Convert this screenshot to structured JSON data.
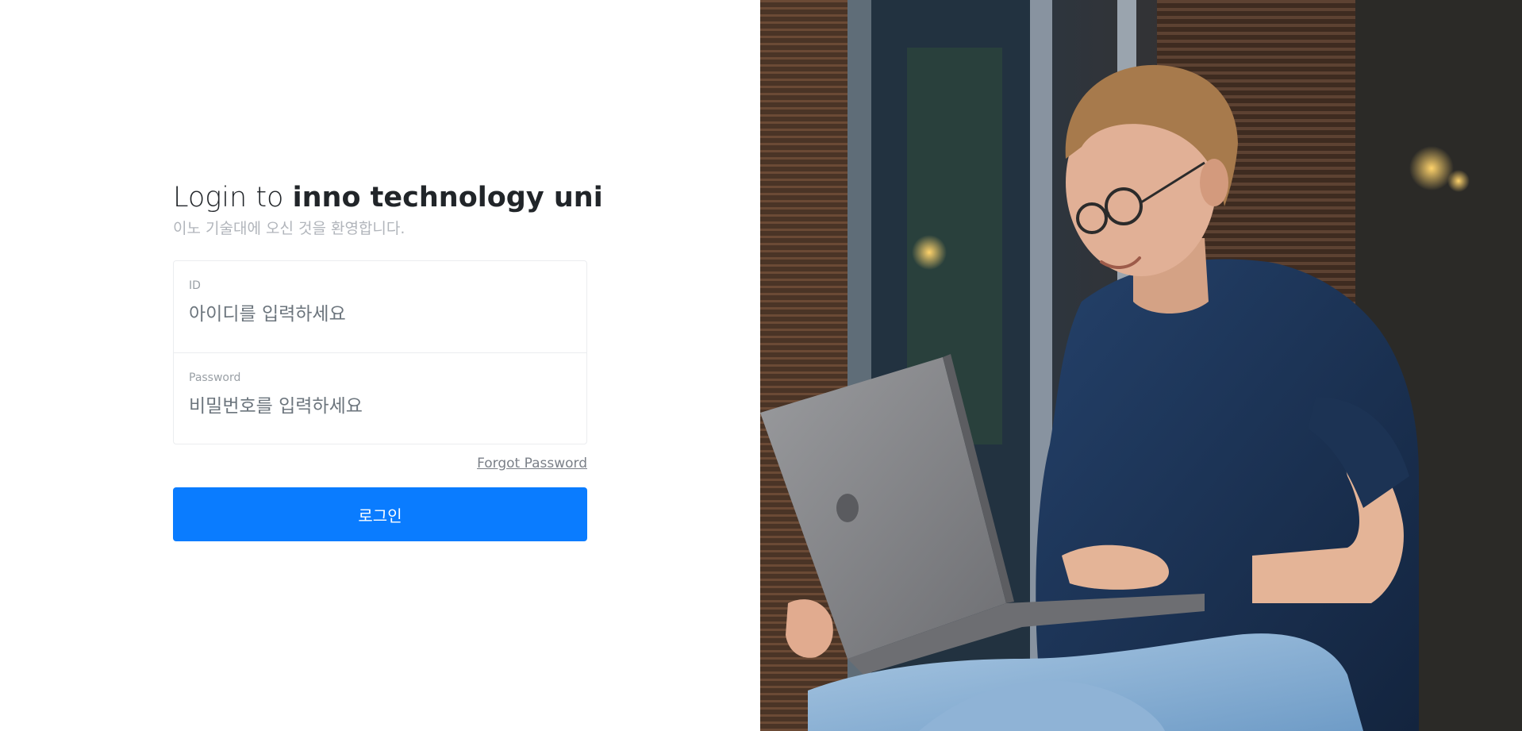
{
  "login": {
    "title_prefix": "Login to ",
    "title_brand": "inno technology uni",
    "subtitle": "이노 기술대에 오신 것을 환영합니다.",
    "id_label": "ID",
    "id_placeholder": "아이디를 입력하세요",
    "password_label": "Password",
    "password_placeholder": "비밀번호를 입력하세요",
    "forgot_label": "Forgot Password",
    "submit_label": "로그인"
  },
  "colors": {
    "accent": "#0a7cff",
    "title_text": "#212529",
    "muted_text": "#b1b5bb"
  },
  "hero_image": {
    "subject": "young man with glasses using laptop outdoors"
  }
}
